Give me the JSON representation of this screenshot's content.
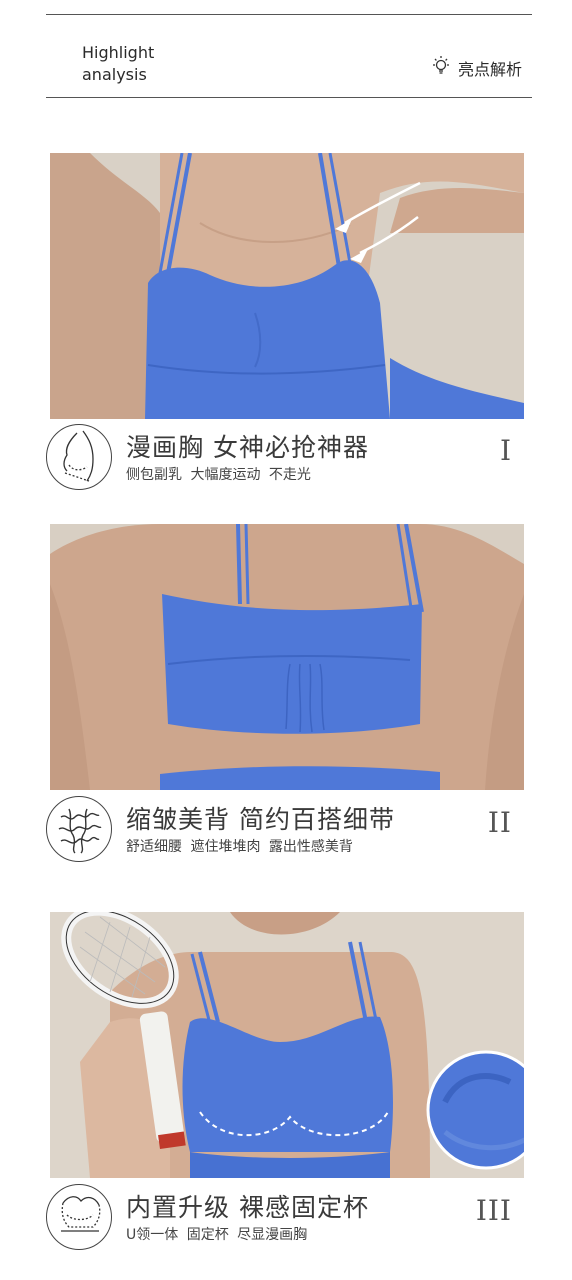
{
  "header": {
    "title_en_line1": "Highlight",
    "title_en_line2": "analysis",
    "title_cn": "亮点解析",
    "icon": "lightbulb-icon"
  },
  "colors": {
    "fabric_blue": "#4f78d8",
    "backdrop": "#dcd4c9",
    "skin": "#d8b49c",
    "line": "#555555"
  },
  "features": [
    {
      "title": "漫画胸 女神必抢神器",
      "subtitle": "侧包副乳 大幅度运动 不走光",
      "numeral": "I",
      "icon": "side-bust-icon"
    },
    {
      "title": "缩皱美背 简约百搭细带",
      "subtitle": "舒适细腰 遮住堆堆肉 露出性感美背",
      "numeral": "II",
      "icon": "ruched-back-icon"
    },
    {
      "title": "内置升级 裸感固定杯",
      "subtitle": "U领一体 固定杯 尽显漫画胸",
      "numeral": "III",
      "icon": "built-in-cup-icon"
    }
  ]
}
